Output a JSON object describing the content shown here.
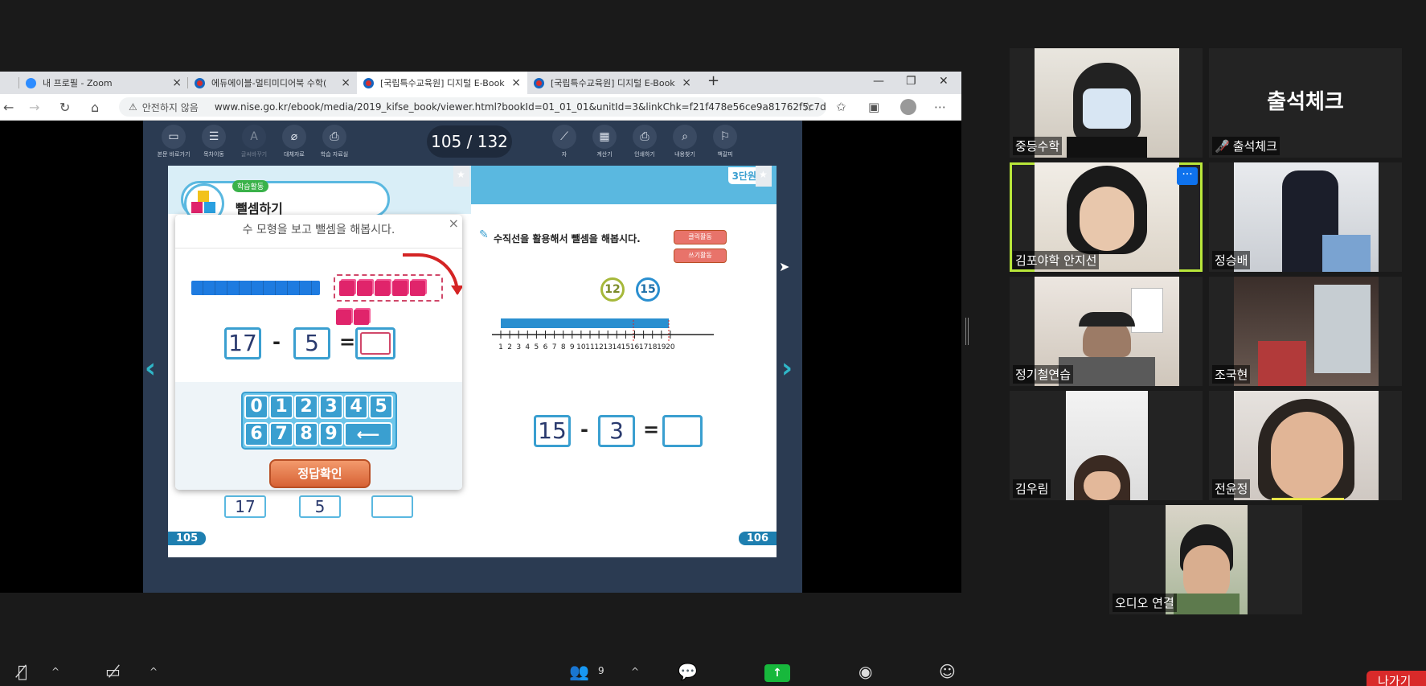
{
  "browser": {
    "tabs": [
      {
        "title": "내 프로필 - Zoom",
        "close": "×"
      },
      {
        "title": "에듀에이블-멀티미디어북 수학(",
        "close": "×"
      },
      {
        "title": "[국립특수교육원] 디지털 E-Book",
        "close": "×"
      },
      {
        "title": "[국립특수교육원] 디지털 E-Book",
        "close": "×"
      }
    ],
    "new_tab": "+",
    "window_buttons": {
      "minimize": "—",
      "restore": "❐",
      "close": "✕"
    },
    "insecure_label": "안전하지 않음",
    "url": "www.nise.go.kr/ebook/media/2019_kifse_book/viewer.html?bookId=01_01_01&unitId=3&linkChk=f21f478e56ce9a81762f5c7d..."
  },
  "ebook": {
    "toolbar": [
      {
        "label": "본문 바로가기",
        "icon": "book-icon"
      },
      {
        "label": "목차이동",
        "icon": "list-icon"
      },
      {
        "label": "글씨바꾸기",
        "icon": "font-icon"
      },
      {
        "label": "대체자료",
        "icon": "paperclip-icon"
      },
      {
        "label": "학습 자료실",
        "icon": "folder-icon"
      },
      {
        "label": "자",
        "icon": "ruler-icon"
      },
      {
        "label": "계산기",
        "icon": "calculator-icon"
      },
      {
        "label": "인쇄하기",
        "icon": "printer-icon"
      },
      {
        "label": "내용찾기",
        "icon": "search-icon"
      },
      {
        "label": "책갈피",
        "icon": "bookmark-icon"
      }
    ],
    "page_indicator": "105 / 132",
    "left_page": {
      "tag": "학습활동",
      "title": "뺄셈하기",
      "page_number": "105",
      "behind_values": [
        "17",
        "5",
        ""
      ]
    },
    "popup": {
      "title": "수 모형을 보고 뺄셈을 해봅시다.",
      "close": "×",
      "equation": {
        "a": "17",
        "op": "-",
        "b": "5",
        "eq": "=",
        "answer": ""
      },
      "keypad_row1": [
        "0",
        "1",
        "2",
        "3",
        "4",
        "5"
      ],
      "keypad_row2": [
        "6",
        "7",
        "8",
        "9"
      ],
      "backspace": "⟵",
      "check_button": "정답확인"
    },
    "right_page": {
      "unit": "3단원",
      "instruction": "수직선을 활용해서 뺄셈을 해봅시다.",
      "click_btn": "클릭활동",
      "write_btn": "쓰기활동",
      "marker_a": "12",
      "marker_b": "15",
      "number_line": [
        "1",
        "2",
        "3",
        "4",
        "5",
        "6",
        "7",
        "8",
        "9",
        "10",
        "11",
        "12",
        "13",
        "14",
        "15",
        "16",
        "17",
        "18",
        "19",
        "20"
      ],
      "equation": {
        "a": "15",
        "op": "-",
        "b": "3",
        "eq": "=",
        "answer": ""
      },
      "page_number": "106"
    }
  },
  "participants": [
    {
      "name": "중등수학",
      "muted": false
    },
    {
      "name": "출석체크",
      "muted": true,
      "big_label": "출석체크"
    },
    {
      "name": "김포야학 안지선",
      "muted": false,
      "speaking": true
    },
    {
      "name": "정승배",
      "muted": false
    },
    {
      "name": "정기철연습",
      "muted": false
    },
    {
      "name": "조국현",
      "muted": false
    },
    {
      "name": "김우림",
      "muted": false
    },
    {
      "name": "전윤정",
      "muted": false
    },
    {
      "name": "오디오 연결",
      "muted": false
    }
  ],
  "controls": {
    "participants_count": "9",
    "leave": "나가기"
  },
  "colors": {
    "accent": "#0e72ed",
    "speaking_border": "#b8e63a",
    "share_green": "#17b83c",
    "leave_red": "#d92a2a"
  }
}
